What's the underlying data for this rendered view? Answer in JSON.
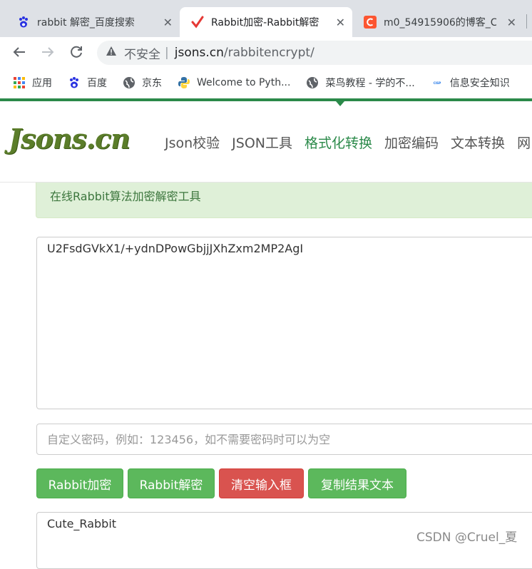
{
  "browser": {
    "tabs": [
      {
        "title": "rabbit 解密_百度搜索",
        "icon": "baidu-paw-icon"
      },
      {
        "title": "Rabbit加密-Rabbit解密",
        "icon": "red-check-icon",
        "active": true
      },
      {
        "title": "m0_54915906的博客_C",
        "icon": "csdn-c-icon"
      }
    ],
    "close_glyph": "✕",
    "address": {
      "security_label": "不安全",
      "host": "jsons.cn",
      "path": "/rabbitencrypt/"
    },
    "bookmarks": [
      {
        "label": "应用",
        "icon": "apps-grid-icon"
      },
      {
        "label": "百度",
        "icon": "baidu-paw-icon"
      },
      {
        "label": "京东",
        "icon": "globe-icon"
      },
      {
        "label": "Welcome to Pyth...",
        "icon": "python-icon"
      },
      {
        "label": "菜鸟教程 - 学的不...",
        "icon": "globe-icon"
      },
      {
        "label": "信息安全知识",
        "icon": "cisp-icon"
      }
    ]
  },
  "site": {
    "logo": "Jsons.cn",
    "nav": [
      {
        "label": "Json校验"
      },
      {
        "label": "JSON工具"
      },
      {
        "label": "格式化转换",
        "active": true
      },
      {
        "label": "加密编码"
      },
      {
        "label": "文本转换"
      },
      {
        "label": "网"
      }
    ],
    "alert": "在线Rabbit算法加密解密工具",
    "input_text": "U2FsdGVkX1/+ydnDPowGbjjJXhZxm2MP2AgI",
    "password_placeholder": "自定义密码，例如：123456，如不需要密码时可以为空",
    "buttons": {
      "encrypt": "Rabbit加密",
      "decrypt": "Rabbit解密",
      "clear": "清空输入框",
      "copy": "复制结果文本"
    },
    "output_text": "Cute_Rabbit"
  },
  "watermark": "CSDN @Cruel_夏",
  "colors": {
    "accent_green": "#2b8a4a",
    "button_green": "#5cb85c",
    "button_red": "#d9534f",
    "alert_bg": "#dff0d8"
  }
}
